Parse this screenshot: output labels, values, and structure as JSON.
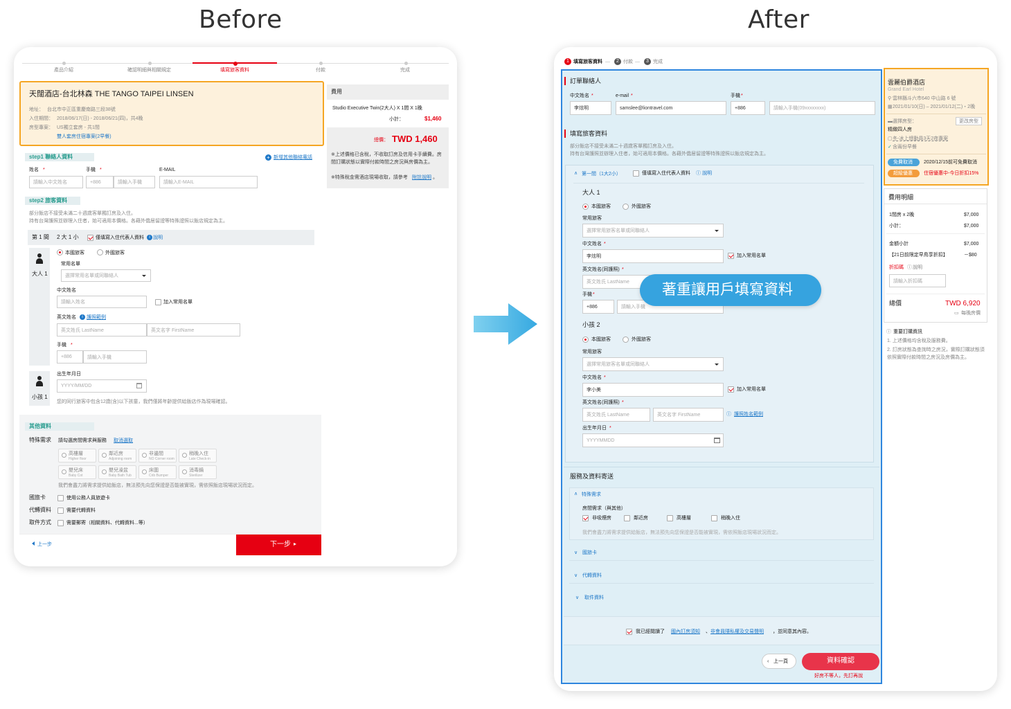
{
  "headings": {
    "before": "Before",
    "after": "After"
  },
  "before": {
    "steps": [
      "產品介紹",
      "確認明細與相關規定",
      "填寫旅客資料",
      "付款",
      "完成"
    ],
    "hotel": {
      "name": "天闊酒店-台北林森 THE TANGO TAIPEI LINSEN",
      "addr_label": "地址：",
      "addr": "台北市中正區重慶南路三段38號",
      "date_label": "入住期間：",
      "date": "2018/06/17(日) - 2018/06/21(四)，共4晚",
      "room_label": "房型專案：",
      "room": "US獨立套房 - 共1間",
      "plan": "雙人套房住宿專案(2早餐)"
    },
    "fee": {
      "title": "費用",
      "item": "Studio Executive Twin(2大人) X 1間 X 1晚",
      "subtotal_label": "小計：",
      "subtotal": "$1,460",
      "total_label": "總價：",
      "total": "TWD 1,460",
      "note1": "※上述價格已含稅，不收取訂房及信用卡手續費。房間訂購狀態以實際付款時間之房況與房價為主。",
      "note2a": "※特殊稅金需酒店現場收取，請參考",
      "note2b": "附註說明",
      "note2c": "。"
    },
    "step1": {
      "title": "step1 聯絡人資料",
      "add_link": "新增其他聯絡電話",
      "name_label": "姓名",
      "phone_label": "手機",
      "email_label": "E-MAIL",
      "name_ph": "請輸入中文姓名",
      "code": "+886",
      "phone_ph": "請輸入手機",
      "email_ph": "請輸入E-MAIL"
    },
    "step2": {
      "title": "step2 旅客資料",
      "desc1": "部分飯店不接受未滿二十週歲客單獨訂房及入住。",
      "desc2": "持有台灣護照並辦理入住者，始可適用本價格。各藉外僑居留證等特殊證照以飯店規定為主。",
      "room_label": "第 1 間",
      "room_count": "2 大 1 小",
      "rep_label": "僅填寫入住代表人資料",
      "explain": "說明",
      "adult": "大人 1",
      "child": "小孩 1",
      "local": "本國旅客",
      "foreign": "外國旅客",
      "common_label": "常用名單",
      "common_ph": "選擇常用名單或同聯絡人",
      "cn_label": "中文姓名",
      "cn_ph": "請輸入姓名",
      "add_common": "加入常用名單",
      "en_label": "英文姓名",
      "en_example": "護照範例",
      "last_ph": "英文姓氏 LastName",
      "first_ph": "英文名字 FirstName",
      "phone_label": "手機",
      "code": "+886",
      "phone_ph": "請輸入手機",
      "birth_label": "出生年月日",
      "birth_ph": "YYYY/MM/DD",
      "child_note": "您的同行旅客中包含12歲(含)以下孩童，我們僅將年齡提供給飯店作為現場確認。"
    },
    "other": {
      "title": "其他資料",
      "special_label": "特殊需求",
      "special_hint": "請勾選房間需求與服務",
      "cancel": "取消選取",
      "tags": [
        [
          "高樓層",
          "Higher floor"
        ],
        [
          "鄰近房",
          "Adjoining room"
        ],
        [
          "非邊間",
          "NO Corner room"
        ],
        [
          "稍晚入住",
          "Late Check-in"
        ],
        [
          "嬰兒床",
          "Baby Cot"
        ],
        [
          "嬰兒澡盆",
          "Baby Bath Tub"
        ],
        [
          "床圍",
          "Crib Bumper"
        ],
        [
          "消毒鍋",
          "Sterilizer"
        ]
      ],
      "note": "我們會盡力將需求提供給飯店，無法預先向您保證是否能被實現，需依照飯店現場狀況而定。",
      "card_label": "國旅卡",
      "card_opt": "使用公務人員旅遊卡",
      "agent_label": "代轉資料",
      "agent_opt": "需要代轉資料",
      "pickup_label": "取件方式",
      "pickup_opt": "需要郵寄（相關資料、代轉資料...等）"
    },
    "prev": "上一步",
    "next": "下一步"
  },
  "after": {
    "steps": [
      "填寫旅客資料",
      "付款",
      "完成"
    ],
    "contact": {
      "title": "訂單聯絡人",
      "cn_label": "中文姓名",
      "email_label": "e-mail",
      "phone_label": "手機",
      "cn": "李炫明",
      "email": "samslee@liontravel.com",
      "code": "+886",
      "phone_ph": "請輸入手機(09xxxxxxxx)"
    },
    "traveler": {
      "title": "填寫旅客資料",
      "desc1": "部分飯店不接受未滿二十週歲客單獨訂房及入住。",
      "desc2": "持有台灣護照並辦理入住者，始可適用本價格。各藉外僑居留證等特殊證照以飯店規定為主。",
      "room": "第一間（1大2小）",
      "rep": "僅填寫入住代表人資料",
      "explain": "說明",
      "adult": "大人 1",
      "child": "小孩 2",
      "local": "本國旅客",
      "foreign": "外國旅客",
      "common_label": "常用旅客",
      "common_ph": "選擇常用旅客名單或同聯絡人",
      "cn_label": "中文姓名",
      "adult_cn": "李炫明",
      "child_cn": "李小美",
      "add_common": "加入常用名單",
      "en_label": "英文姓名(同護照)",
      "last_ph": "英文姓氏 LastName",
      "first_ph": "英文名字 FirstName",
      "en_example": "護照姓名範例",
      "phone_label": "手機",
      "code": "+886",
      "phone_ph": "請輸入手機",
      "birth_label": "出生年月日",
      "birth_ph": "YYYYMMDD"
    },
    "badge": "著重讓用戶填寫資料",
    "service": {
      "title": "服務及資料寄送",
      "special": "特殊需求",
      "room_req": "房間需求（與其他）",
      "opts": [
        "非吸煙房",
        "鄰近房",
        "高樓層",
        "稍晚入住"
      ],
      "note": "我們會盡力將需求提供給飯店，無法預先向您保證是否能被實現，需依照飯店現場狀況而定。",
      "card": "國旅卡",
      "agent": "代轉資料",
      "pickup": "取件資料"
    },
    "agree_a": "我已經閱讀了",
    "agree_b": "國內訂房須知",
    "agree_c": "、",
    "agree_d": "非會員隱私權及交易聲明",
    "agree_e": "，並同意其內容。",
    "prev": "上一頁",
    "confirm": "資料確認",
    "slogan": "好房不等人，先訂再說",
    "hotel": {
      "name": "雲麗伯爵酒店",
      "en": "Grand Earl Hotel",
      "addr": "雲林縣斗六市640 中山路 6 號",
      "date": "2021/01/10(日) – 2021/01/12(二)・2晚",
      "room_label": "選擇房型：",
      "change": "更改房型",
      "room": "精緻四人房",
      "plan": "冬-冰上總動員3天2夜專案",
      "breakfast": "含兩份早餐",
      "free_cancel": "免費取消",
      "free_note": "2020/12/15前可免費取消",
      "limited": "超級優惠",
      "limited_note": "住宿優惠中-今日折扣15%"
    },
    "fee": {
      "title": "費用明細",
      "l1": "1間房 x 2晚",
      "v1": "$7,000",
      "l2": "小計：",
      "v2": "$7,000",
      "l3": "金額小計",
      "v3": "$7,000",
      "l4": "【21日前限定早鳥享折扣】",
      "v4": "－$80",
      "promo": "折扣碼",
      "explain": "說明",
      "promo_ph": "請輸入折扣碼",
      "total_label": "總價",
      "total": "TWD 6,920",
      "per": "每晚房價"
    },
    "notes": {
      "title": "重要訂購資訊",
      "n1": "1. 上述價格均含稅及服務費。",
      "n2": "2. 訂房狀態為查詢時之房況，實際訂購狀態須依照實際付款時間之房況及房價為主。"
    }
  }
}
